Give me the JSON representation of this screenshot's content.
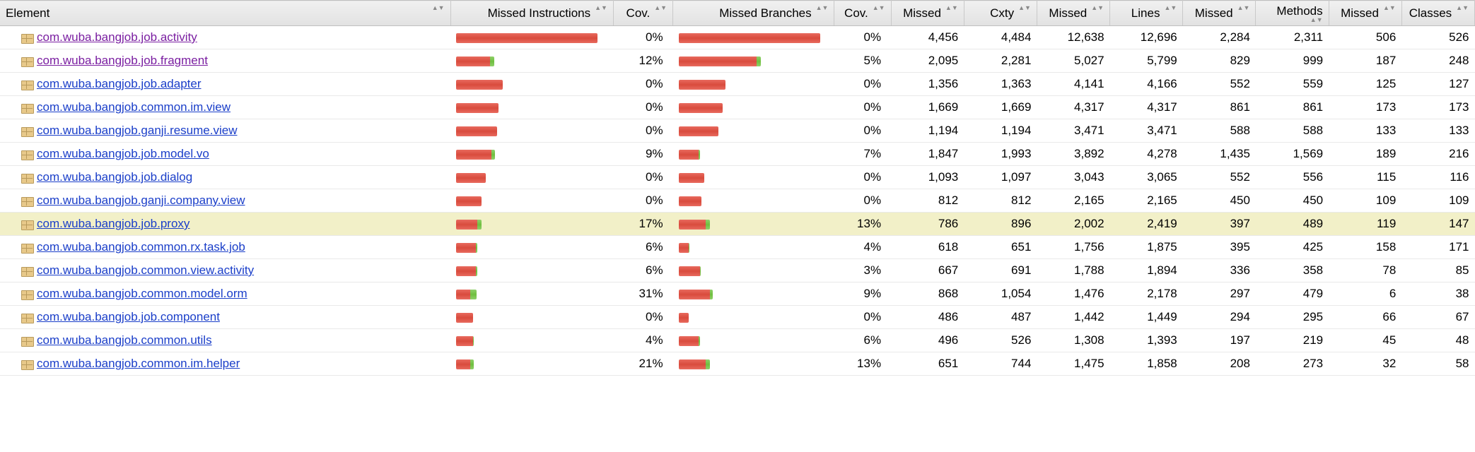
{
  "columns": {
    "element": "Element",
    "missed_instr": "Missed Instructions",
    "cov1": "Cov.",
    "missed_branches": "Missed Branches",
    "cov2": "Cov.",
    "missed_cxty": "Missed",
    "cxty": "Cxty",
    "missed_lines": "Missed",
    "lines": "Lines",
    "missed_methods": "Missed",
    "methods": "Methods",
    "missed_classes": "Missed",
    "classes": "Classes"
  },
  "bar_scale": {
    "instr_max": 200,
    "branch_max": 200
  },
  "rows": [
    {
      "name": "com.wuba.bangjob.job.activity",
      "visited": true,
      "hl": false,
      "instr_bar": {
        "red": 200,
        "green": 0
      },
      "instr_cov": "0%",
      "branch_bar": {
        "red": 200,
        "green": 0
      },
      "branch_cov": "0%",
      "m_cxty": "4,456",
      "cxty": "4,484",
      "m_lines": "12,638",
      "lines": "12,696",
      "m_meth": "2,284",
      "meth": "2,311",
      "m_cls": "506",
      "cls": "526"
    },
    {
      "name": "com.wuba.bangjob.job.fragment",
      "visited": true,
      "hl": false,
      "instr_bar": {
        "red": 48,
        "green": 6
      },
      "instr_cov": "12%",
      "branch_bar": {
        "red": 110,
        "green": 6
      },
      "branch_cov": "5%",
      "m_cxty": "2,095",
      "cxty": "2,281",
      "m_lines": "5,027",
      "lines": "5,799",
      "m_meth": "829",
      "meth": "999",
      "m_cls": "187",
      "cls": "248"
    },
    {
      "name": "com.wuba.bangjob.job.adapter",
      "visited": false,
      "hl": false,
      "instr_bar": {
        "red": 66,
        "green": 0
      },
      "instr_cov": "0%",
      "branch_bar": {
        "red": 66,
        "green": 0
      },
      "branch_cov": "0%",
      "m_cxty": "1,356",
      "cxty": "1,363",
      "m_lines": "4,141",
      "lines": "4,166",
      "m_meth": "552",
      "meth": "559",
      "m_cls": "125",
      "cls": "127"
    },
    {
      "name": "com.wuba.bangjob.common.im.view",
      "visited": false,
      "hl": false,
      "instr_bar": {
        "red": 60,
        "green": 0
      },
      "instr_cov": "0%",
      "branch_bar": {
        "red": 62,
        "green": 0
      },
      "branch_cov": "0%",
      "m_cxty": "1,669",
      "cxty": "1,669",
      "m_lines": "4,317",
      "lines": "4,317",
      "m_meth": "861",
      "meth": "861",
      "m_cls": "173",
      "cls": "173"
    },
    {
      "name": "com.wuba.bangjob.ganji.resume.view",
      "visited": false,
      "hl": false,
      "instr_bar": {
        "red": 58,
        "green": 0
      },
      "instr_cov": "0%",
      "branch_bar": {
        "red": 56,
        "green": 0
      },
      "branch_cov": "0%",
      "m_cxty": "1,194",
      "cxty": "1,194",
      "m_lines": "3,471",
      "lines": "3,471",
      "m_meth": "588",
      "meth": "588",
      "m_cls": "133",
      "cls": "133"
    },
    {
      "name": "com.wuba.bangjob.job.model.vo",
      "visited": false,
      "hl": false,
      "instr_bar": {
        "red": 50,
        "green": 5
      },
      "instr_cov": "9%",
      "branch_bar": {
        "red": 28,
        "green": 2
      },
      "branch_cov": "7%",
      "m_cxty": "1,847",
      "cxty": "1,993",
      "m_lines": "3,892",
      "lines": "4,278",
      "m_meth": "1,435",
      "meth": "1,569",
      "m_cls": "189",
      "cls": "216"
    },
    {
      "name": "com.wuba.bangjob.job.dialog",
      "visited": false,
      "hl": false,
      "instr_bar": {
        "red": 42,
        "green": 0
      },
      "instr_cov": "0%",
      "branch_bar": {
        "red": 36,
        "green": 0
      },
      "branch_cov": "0%",
      "m_cxty": "1,093",
      "cxty": "1,097",
      "m_lines": "3,043",
      "lines": "3,065",
      "m_meth": "552",
      "meth": "556",
      "m_cls": "115",
      "cls": "116"
    },
    {
      "name": "com.wuba.bangjob.ganji.company.view",
      "visited": false,
      "hl": false,
      "instr_bar": {
        "red": 36,
        "green": 0
      },
      "instr_cov": "0%",
      "branch_bar": {
        "red": 32,
        "green": 0
      },
      "branch_cov": "0%",
      "m_cxty": "812",
      "cxty": "812",
      "m_lines": "2,165",
      "lines": "2,165",
      "m_meth": "450",
      "meth": "450",
      "m_cls": "109",
      "cls": "109"
    },
    {
      "name": "com.wuba.bangjob.job.proxy",
      "visited": false,
      "hl": true,
      "instr_bar": {
        "red": 30,
        "green": 6
      },
      "instr_cov": "17%",
      "branch_bar": {
        "red": 38,
        "green": 6
      },
      "branch_cov": "13%",
      "m_cxty": "786",
      "cxty": "896",
      "m_lines": "2,002",
      "lines": "2,419",
      "m_meth": "397",
      "meth": "489",
      "m_cls": "119",
      "cls": "147"
    },
    {
      "name": "com.wuba.bangjob.common.rx.task.job",
      "visited": false,
      "hl": false,
      "instr_bar": {
        "red": 28,
        "green": 2
      },
      "instr_cov": "6%",
      "branch_bar": {
        "red": 14,
        "green": 1
      },
      "branch_cov": "4%",
      "m_cxty": "618",
      "cxty": "651",
      "m_lines": "1,756",
      "lines": "1,875",
      "m_meth": "395",
      "meth": "425",
      "m_cls": "158",
      "cls": "171"
    },
    {
      "name": "com.wuba.bangjob.common.view.activity",
      "visited": false,
      "hl": false,
      "instr_bar": {
        "red": 28,
        "green": 2
      },
      "instr_cov": "6%",
      "branch_bar": {
        "red": 30,
        "green": 1
      },
      "branch_cov": "3%",
      "m_cxty": "667",
      "cxty": "691",
      "m_lines": "1,788",
      "lines": "1,894",
      "m_meth": "336",
      "meth": "358",
      "m_cls": "78",
      "cls": "85"
    },
    {
      "name": "com.wuba.bangjob.common.model.orm",
      "visited": false,
      "hl": false,
      "instr_bar": {
        "red": 20,
        "green": 9
      },
      "instr_cov": "31%",
      "branch_bar": {
        "red": 44,
        "green": 4
      },
      "branch_cov": "9%",
      "m_cxty": "868",
      "cxty": "1,054",
      "m_lines": "1,476",
      "lines": "2,178",
      "m_meth": "297",
      "meth": "479",
      "m_cls": "6",
      "cls": "38"
    },
    {
      "name": "com.wuba.bangjob.job.component",
      "visited": false,
      "hl": false,
      "instr_bar": {
        "red": 24,
        "green": 0
      },
      "instr_cov": "0%",
      "branch_bar": {
        "red": 14,
        "green": 0
      },
      "branch_cov": "0%",
      "m_cxty": "486",
      "cxty": "487",
      "m_lines": "1,442",
      "lines": "1,449",
      "m_meth": "294",
      "meth": "295",
      "m_cls": "66",
      "cls": "67"
    },
    {
      "name": "com.wuba.bangjob.common.utils",
      "visited": false,
      "hl": false,
      "instr_bar": {
        "red": 24,
        "green": 1
      },
      "instr_cov": "4%",
      "branch_bar": {
        "red": 28,
        "green": 2
      },
      "branch_cov": "6%",
      "m_cxty": "496",
      "cxty": "526",
      "m_lines": "1,308",
      "lines": "1,393",
      "m_meth": "197",
      "meth": "219",
      "m_cls": "45",
      "cls": "48"
    },
    {
      "name": "com.wuba.bangjob.common.im.helper",
      "visited": false,
      "hl": false,
      "instr_bar": {
        "red": 20,
        "green": 5
      },
      "instr_cov": "21%",
      "branch_bar": {
        "red": 38,
        "green": 6
      },
      "branch_cov": "13%",
      "m_cxty": "651",
      "cxty": "744",
      "m_lines": "1,475",
      "lines": "1,858",
      "m_meth": "208",
      "meth": "273",
      "m_cls": "32",
      "cls": "58"
    }
  ],
  "chart_data": {
    "type": "table",
    "title": "JaCoCo Code Coverage Report by Package",
    "columns": [
      "Element",
      "Instr Cov %",
      "Branch Cov %",
      "Missed Cxty",
      "Cxty",
      "Missed Lines",
      "Lines",
      "Missed Methods",
      "Methods",
      "Missed Classes",
      "Classes"
    ],
    "rows": [
      [
        "com.wuba.bangjob.job.activity",
        0,
        0,
        4456,
        4484,
        12638,
        12696,
        2284,
        2311,
        506,
        526
      ],
      [
        "com.wuba.bangjob.job.fragment",
        12,
        5,
        2095,
        2281,
        5027,
        5799,
        829,
        999,
        187,
        248
      ],
      [
        "com.wuba.bangjob.job.adapter",
        0,
        0,
        1356,
        1363,
        4141,
        4166,
        552,
        559,
        125,
        127
      ],
      [
        "com.wuba.bangjob.common.im.view",
        0,
        0,
        1669,
        1669,
        4317,
        4317,
        861,
        861,
        173,
        173
      ],
      [
        "com.wuba.bangjob.ganji.resume.view",
        0,
        0,
        1194,
        1194,
        3471,
        3471,
        588,
        588,
        133,
        133
      ],
      [
        "com.wuba.bangjob.job.model.vo",
        9,
        7,
        1847,
        1993,
        3892,
        4278,
        1435,
        1569,
        189,
        216
      ],
      [
        "com.wuba.bangjob.job.dialog",
        0,
        0,
        1093,
        1097,
        3043,
        3065,
        552,
        556,
        115,
        116
      ],
      [
        "com.wuba.bangjob.ganji.company.view",
        0,
        0,
        812,
        812,
        2165,
        2165,
        450,
        450,
        109,
        109
      ],
      [
        "com.wuba.bangjob.job.proxy",
        17,
        13,
        786,
        896,
        2002,
        2419,
        397,
        489,
        119,
        147
      ],
      [
        "com.wuba.bangjob.common.rx.task.job",
        6,
        4,
        618,
        651,
        1756,
        1875,
        395,
        425,
        158,
        171
      ],
      [
        "com.wuba.bangjob.common.view.activity",
        6,
        3,
        667,
        691,
        1788,
        1894,
        336,
        358,
        78,
        85
      ],
      [
        "com.wuba.bangjob.common.model.orm",
        31,
        9,
        868,
        1054,
        1476,
        2178,
        297,
        479,
        6,
        38
      ],
      [
        "com.wuba.bangjob.job.component",
        0,
        0,
        486,
        487,
        1442,
        1449,
        294,
        295,
        66,
        67
      ],
      [
        "com.wuba.bangjob.common.utils",
        4,
        6,
        496,
        526,
        1308,
        1393,
        197,
        219,
        45,
        48
      ],
      [
        "com.wuba.bangjob.common.im.helper",
        21,
        13,
        651,
        744,
        1475,
        1858,
        208,
        273,
        32,
        58
      ]
    ]
  }
}
